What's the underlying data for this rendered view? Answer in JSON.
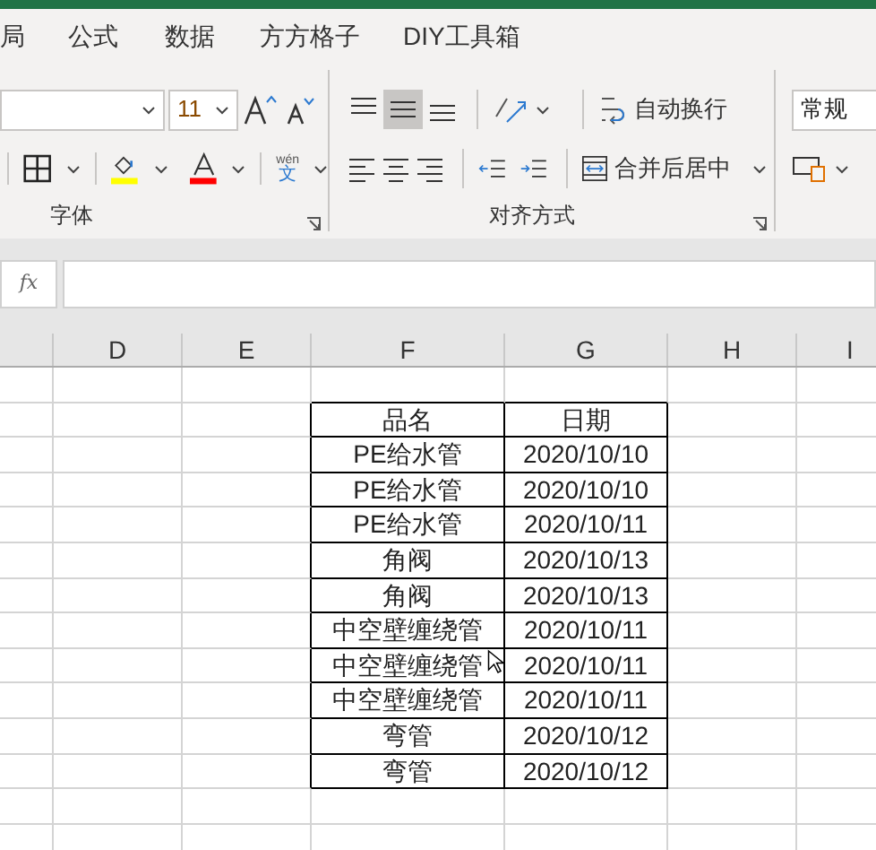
{
  "tabs": [
    {
      "label": "局"
    },
    {
      "label": "公式"
    },
    {
      "label": "数据"
    },
    {
      "label": "方方格子"
    },
    {
      "label": "DIY工具箱"
    }
  ],
  "font_group": {
    "font_size": "11",
    "phonetic_top": "wén",
    "phonetic_bottom": "文",
    "label": "字体"
  },
  "align_group": {
    "top_buttons": [
      {
        "kind": "top",
        "selected": false
      },
      {
        "kind": "middle",
        "selected": true
      },
      {
        "kind": "bottom",
        "selected": false
      }
    ],
    "bottom_buttons": [
      {
        "kind": "left",
        "selected": false
      },
      {
        "kind": "center",
        "selected": false
      },
      {
        "kind": "right",
        "selected": false
      }
    ],
    "wrap_text": "自动换行",
    "merge_center": "合并后居中",
    "label": "对齐方式"
  },
  "number_group": {
    "format": "常规"
  },
  "formula_bar": {
    "fx": "fx"
  },
  "columns": [
    "",
    "D",
    "E",
    "F",
    "G",
    "H",
    "I"
  ],
  "table": {
    "header": [
      "品名",
      "日期"
    ],
    "rows": [
      [
        "PE给水管",
        "2020/10/10"
      ],
      [
        "PE给水管",
        "2020/10/10"
      ],
      [
        "PE给水管",
        "2020/10/11"
      ],
      [
        "角阀",
        "2020/10/13"
      ],
      [
        "角阀",
        "2020/10/13"
      ],
      [
        "中空壁缠绕管",
        "2020/10/11"
      ],
      [
        "中空壁缠绕管",
        "2020/10/11"
      ],
      [
        "中空壁缠绕管",
        "2020/10/11"
      ],
      [
        "弯管",
        "2020/10/12"
      ],
      [
        "弯管",
        "2020/10/12"
      ]
    ]
  }
}
